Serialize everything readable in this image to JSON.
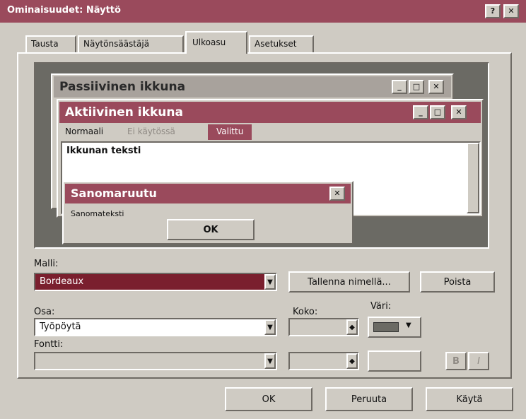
{
  "window": {
    "title": "Ominaisuudet: Näyttö",
    "close_glyph": "✕",
    "help_glyph": "?"
  },
  "tabs": [
    "Tausta",
    "Näytönsäästäjä",
    "Ulkoasu",
    "Asetukset"
  ],
  "preview": {
    "inactive_title": "Passiivinen ikkuna",
    "active_title": "Aktiivinen ikkuna",
    "menu_normal": "Normaali",
    "menu_disabled": "Ei käytössä",
    "menu_selected": "Valittu",
    "window_text": "Ikkunan teksti",
    "msgbox_title": "Sanomaruutu",
    "msgbox_text": "Sanomateksti",
    "ok_label": "OK",
    "min_glyph": "_",
    "max_glyph": "□",
    "close_glyph": "✕"
  },
  "scheme": {
    "label": "Malli:",
    "value": "Bordeaux",
    "save_as": "Tallenna nimellä...",
    "delete": "Poista"
  },
  "item": {
    "label": "Osa:",
    "value": "Työpöytä",
    "size_label": "Koko:",
    "color_label": "Väri:"
  },
  "font": {
    "label": "Fontti:",
    "value": ""
  },
  "bold_glyph": "B",
  "italic_glyph": "I",
  "buttons": {
    "ok": "OK",
    "cancel": "Peruuta",
    "apply": "Käytä"
  },
  "colors": {
    "titlebar": "#9a4a5c",
    "scheme_dropdown": "#7a1f2e",
    "preview_bg": "#6b6a64"
  }
}
